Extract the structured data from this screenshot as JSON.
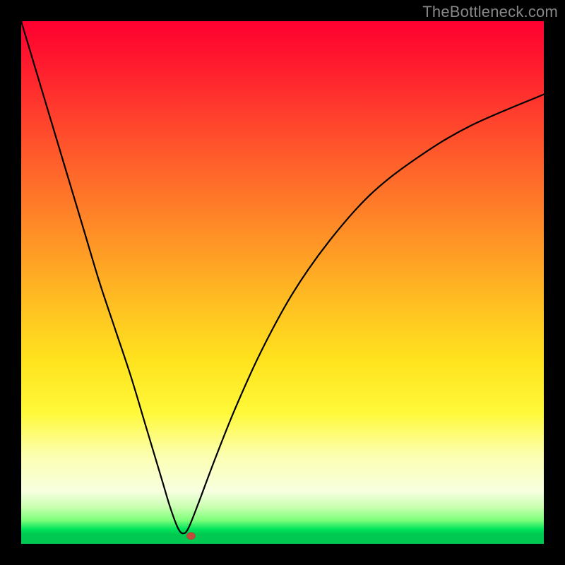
{
  "watermark": "TheBottleneck.com",
  "colors": {
    "frame": "#000000",
    "curve": "#000000",
    "dot": "#c24a3a",
    "gradient_top": "#ff0030",
    "gradient_bottom": "#00c850"
  },
  "chart_data": {
    "type": "line",
    "title": "",
    "xlabel": "",
    "ylabel": "",
    "xlim": [
      0,
      100
    ],
    "ylim": [
      0,
      100
    ],
    "grid": false,
    "legend": false,
    "notch": {
      "x": 31,
      "y": 2
    },
    "marker": {
      "x": 32.5,
      "y": 1.5
    },
    "series": [
      {
        "name": "bottleneck-curve",
        "x": [
          0,
          3,
          6,
          9,
          12,
          15,
          18,
          21,
          24,
          27,
          28.5,
          30,
          31,
          32,
          34,
          37,
          41,
          46,
          52,
          59,
          67,
          76,
          86,
          100
        ],
        "y": [
          100,
          90,
          80,
          70,
          60,
          50,
          41,
          32,
          22,
          12,
          7,
          3,
          2,
          3,
          8,
          16,
          26,
          37,
          48,
          58,
          67,
          74,
          80,
          86
        ]
      }
    ]
  }
}
